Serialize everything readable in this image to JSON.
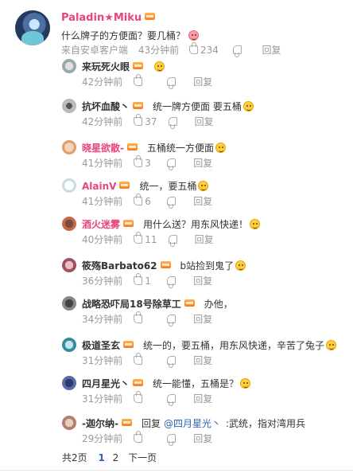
{
  "main": {
    "username": "Paladin★Miku",
    "text": "什么牌子的方便面？要几桶？",
    "source": "来自安卓客户端",
    "time": "43分钟前",
    "likes": "234",
    "reply_label": "回复"
  },
  "replies": [
    {
      "username": "来玩死火眼",
      "color": "#333333",
      "text": "",
      "time": "42分钟前",
      "likes": "",
      "reply_label": "回复"
    },
    {
      "username": "抗坏血酸丶",
      "color": "#333333",
      "text": "统一牌方便面 要五桶",
      "time": "42分钟前",
      "likes": "37",
      "reply_label": "回复"
    },
    {
      "username": "晓星欲散-",
      "color": "#e8457a",
      "text": "五桶统一方便面",
      "time": "41分钟前",
      "likes": "3",
      "reply_label": "回复"
    },
    {
      "username": "AlainV",
      "color": "#e8457a",
      "text": "统一，要五桶",
      "time": "41分钟前",
      "likes": "6",
      "reply_label": "回复"
    },
    {
      "username": "酒火迷雾",
      "color": "#e8457a",
      "text": "用什么送？用东风快递！",
      "time": "40分钟前",
      "likes": "11",
      "reply_label": "回复"
    },
    {
      "username": "筱殇Barbato62",
      "color": "#333333",
      "text": "b站捡到鬼了",
      "time": "36分钟前",
      "likes": "1",
      "reply_label": "回复"
    },
    {
      "username": "战略恐吓局18号除草工",
      "color": "#333333",
      "text": "办他，",
      "time": "34分钟前",
      "likes": "",
      "reply_label": "回复"
    },
    {
      "username": "极道圣玄",
      "color": "#333333",
      "text": "统一的，要五桶，用东风快递，辛苦了兔子",
      "time": "31分钟前",
      "likes": "",
      "reply_label": "回复"
    },
    {
      "username": "四月星光丶",
      "color": "#333333",
      "text": "统一能懂，五桶是？",
      "time": "31分钟前",
      "likes": "",
      "reply_label": "回复"
    },
    {
      "username": "-迦尔纳-",
      "color": "#333333",
      "text_prefix": "回复",
      "mention": "@四月星光丶",
      "text": ":武统，指对湾用兵",
      "time": "29分钟前",
      "likes": "",
      "reply_label": "回复"
    }
  ],
  "pagination": {
    "total": "共2页",
    "page1": "1",
    "page2": "2",
    "next": "下一页"
  },
  "colors": {
    "accent_pink": "#e8457a",
    "link_blue": "#2d64b3",
    "meta_gray": "#999999"
  }
}
